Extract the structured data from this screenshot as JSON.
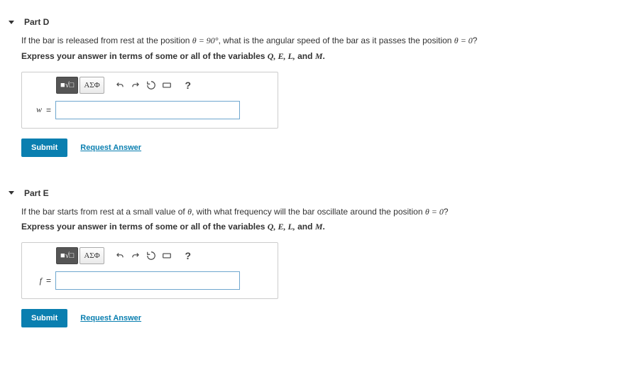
{
  "parts": [
    {
      "title": "Part D",
      "question_pre": "If the bar is released from rest at the position ",
      "question_theta1": "θ = 90°",
      "question_mid": ", what is the angular speed of the bar as it passes the position ",
      "question_theta2": "θ = 0",
      "question_post": "?",
      "instruction_pre": "Express your answer in terms of some or all of the variables ",
      "instruction_vars": "Q, E, L,",
      "instruction_and": " and ",
      "instruction_lastvar": "M",
      "instruction_post": ".",
      "var_label": "w",
      "submit": "Submit",
      "request": "Request Answer",
      "toolbar": {
        "template": "■√□",
        "greek": "ΑΣΦ",
        "help": "?"
      }
    },
    {
      "title": "Part E",
      "question_pre": "If the bar starts from rest at a small value of ",
      "question_theta1": "θ",
      "question_mid": ", with what frequency will the bar oscillate around the position ",
      "question_theta2": "θ = 0",
      "question_post": "?",
      "instruction_pre": "Express your answer in terms of some or all of the variables ",
      "instruction_vars": "Q, E, L,",
      "instruction_and": " and ",
      "instruction_lastvar": "M",
      "instruction_post": ".",
      "var_label": "f",
      "submit": "Submit",
      "request": "Request Answer",
      "toolbar": {
        "template": "■√□",
        "greek": "ΑΣΦ",
        "help": "?"
      }
    }
  ]
}
